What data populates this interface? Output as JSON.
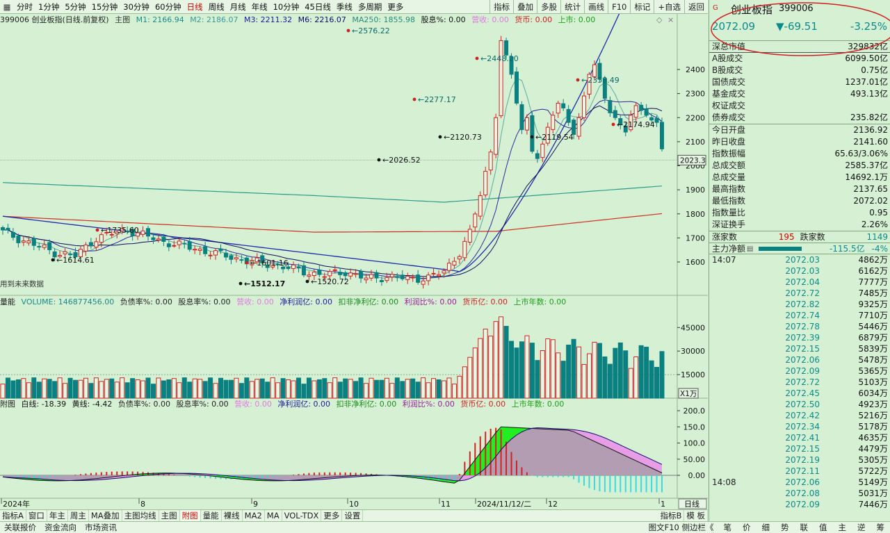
{
  "top_periods": [
    {
      "label": "分时",
      "active": false
    },
    {
      "label": "1分钟",
      "active": false
    },
    {
      "label": "5分钟",
      "active": false
    },
    {
      "label": "15分钟",
      "active": false
    },
    {
      "label": "30分钟",
      "active": false
    },
    {
      "label": "60分钟",
      "active": false
    },
    {
      "label": "日线",
      "active": true
    },
    {
      "label": "周线",
      "active": false
    },
    {
      "label": "月线",
      "active": false
    },
    {
      "label": "年线",
      "active": false
    },
    {
      "label": "10分钟",
      "active": false
    },
    {
      "label": "45日线",
      "active": false
    },
    {
      "label": "季线",
      "active": false
    },
    {
      "label": "多周期",
      "active": false
    },
    {
      "label": "更多",
      "active": false
    }
  ],
  "tool_buttons": [
    "指标",
    "叠加",
    "多股",
    "统计",
    "画线",
    "F10",
    "标记",
    "+自选",
    "返回"
  ],
  "main_info": {
    "title": "399006 创业板指(日线.前复权)",
    "main_label": "主图",
    "m1": "M1: 2166.94",
    "m2": "M2: 2186.07",
    "m3": "M3: 2211.32",
    "m6": "M6: 2216.07",
    "ma250": "MA250: 1855.98",
    "gxl": "股息%: 0.00",
    "yingshou": "营收: 0.00",
    "huobi": "货币: 0.00",
    "shangshi": "上市: 0.00"
  },
  "volume_info": {
    "label": "量能",
    "volume": "VOLUME: 146877456.00",
    "fzl": "负债率%: 0.00",
    "gxl": "股息率%: 0.00",
    "yingshou": "营收: 0.00",
    "jlr": "净利润亿: 0.00",
    "kfjlr": "扣非净利亿: 0.00",
    "lrb": "利润比%: 0.00",
    "hby": "货币亿: 0.00",
    "ssns": "上市年数: 0.00"
  },
  "macd_info": {
    "label": "附图",
    "white": "白线: -18.39",
    "yellow": "黄线: -4.42",
    "fzl": "负债率%: 0.00",
    "gxl": "股息率%: 0.00",
    "yingshou": "营收: 0.00",
    "jlr": "净利润亿: 0.00",
    "kfjlr": "扣非净利亿: 0.00",
    "lrb": "利润比%: 0.00",
    "hby": "货币亿: 0.00",
    "ssns": "上市年数: 0.00"
  },
  "future_data_note": "用到未来数据",
  "price_axis": [
    "2400",
    "2300",
    "2200",
    "2100",
    "2000",
    "1900",
    "1800",
    "1700",
    "1600"
  ],
  "current_price_tag": "2023.3",
  "vol_axis": [
    "45000",
    "30000",
    "15000"
  ],
  "vol_unit": "X1万",
  "macd_axis": [
    "200.0",
    "150.0",
    "100.0",
    "50.00",
    "0.00"
  ],
  "x_labels": [
    {
      "label": "2024年",
      "pos": 0
    },
    {
      "label": "8",
      "pos": 1
    },
    {
      "label": "9",
      "pos": 2
    },
    {
      "label": "10",
      "pos": 3
    },
    {
      "label": "11",
      "pos": 4
    },
    {
      "label": "2024/11/12/二",
      "pos": 5
    },
    {
      "label": "12",
      "pos": 6
    },
    {
      "label": "1",
      "pos": 7
    }
  ],
  "period_tag": "日线",
  "annotations": [
    {
      "label": "2576.22",
      "price": 2576.22
    },
    {
      "label": "2448.20",
      "price": 2448.2
    },
    {
      "label": "2358.49",
      "price": 2358.49
    },
    {
      "label": "2277.17",
      "price": 2277.17
    },
    {
      "label": "2120.73",
      "price": 2120.73
    },
    {
      "label": "2119.54",
      "price": 2119.54
    },
    {
      "label": "2174.94",
      "price": 2174.94
    },
    {
      "label": "2026.52",
      "price": 2026.52
    },
    {
      "label": "1735.60",
      "price": 1735.6
    },
    {
      "label": "1614.61",
      "price": 1614.61
    },
    {
      "label": "1601.16",
      "price": 1601.16
    },
    {
      "label": "1512.17",
      "price": 1512.17
    },
    {
      "label": "1520.72",
      "price": 1520.72
    }
  ],
  "bottom_tabs": [
    {
      "label": "指标A",
      "active": false
    },
    {
      "label": "窗口",
      "active": false
    },
    {
      "label": "年主",
      "active": false
    },
    {
      "label": "周主",
      "active": false
    },
    {
      "label": "MA叠加",
      "active": false
    },
    {
      "label": "主图均线",
      "active": false
    },
    {
      "label": "主图",
      "active": false
    },
    {
      "label": "附图",
      "active": true
    },
    {
      "label": "量能",
      "active": false
    },
    {
      "label": "裸线",
      "active": false
    },
    {
      "label": "MA2",
      "active": false
    },
    {
      "label": "MA",
      "active": false
    },
    {
      "label": "VOL-TDX",
      "active": false
    },
    {
      "label": "更多",
      "active": false
    },
    {
      "label": "设置",
      "active": false
    }
  ],
  "bottom_right_tabs": [
    "指标B",
    "模 板"
  ],
  "status_left": [
    "关联报价",
    "资金流向",
    "市场资讯"
  ],
  "status_right_label": "图文F10 侧边栏《",
  "status_right": [
    "笔",
    "价",
    "细",
    "势",
    "联",
    "值",
    "主",
    "逆",
    "筹"
  ],
  "quote": {
    "name": "创业板指",
    "code": "399006",
    "price": "2072.09",
    "change": "▼-69.51",
    "pct": "-3.25%",
    "accent": "#0a8a8a",
    "circle_color": "#d02020"
  },
  "stats_top": [
    {
      "label": "深总市值",
      "value": "329832亿"
    },
    {
      "label": "A股成交",
      "value": "6099.50亿"
    },
    {
      "label": "B股成交",
      "value": "0.75亿"
    },
    {
      "label": "国债成交",
      "value": "1237.01亿"
    },
    {
      "label": "基金成交",
      "value": "493.13亿"
    },
    {
      "label": "权证成交",
      "value": ""
    },
    {
      "label": "债券成交",
      "value": "235.82亿"
    }
  ],
  "stats_bottom": [
    {
      "label": "今日开盘",
      "value": "2136.92",
      "color": "grn"
    },
    {
      "label": "昨日收盘",
      "value": "2141.60",
      "color": ""
    },
    {
      "label": "指数振幅",
      "value": "65.63/3.06%",
      "color": ""
    },
    {
      "label": "总成交额",
      "value": "2585.37亿",
      "color": ""
    },
    {
      "label": "总成交量",
      "value": "14692.1万",
      "color": ""
    },
    {
      "label": "最高指数",
      "value": "2137.65",
      "color": "grn"
    },
    {
      "label": "最低指数",
      "value": "2072.02",
      "color": "grn"
    },
    {
      "label": "指数量比",
      "value": "0.95",
      "color": "red"
    },
    {
      "label": "深证换手",
      "value": "2.26%",
      "color": ""
    }
  ],
  "breadth": {
    "up_label": "涨家数",
    "up_value": "195",
    "down_label": "跌家数",
    "down_value": "1149"
  },
  "net_flow": {
    "label": "主力净额",
    "value": "-115.5亿",
    "pct": "-4%"
  },
  "trades": [
    {
      "time": "14:07",
      "price": "2072.03",
      "qty": "4862万"
    },
    {
      "time": "",
      "price": "2072.03",
      "qty": "6162万"
    },
    {
      "time": "",
      "price": "2072.04",
      "qty": "7777万"
    },
    {
      "time": "",
      "price": "2072.72",
      "qty": "7485万"
    },
    {
      "time": "",
      "price": "2072.82",
      "qty": "9325万"
    },
    {
      "time": "",
      "price": "2072.74",
      "qty": "7710万"
    },
    {
      "time": "",
      "price": "2072.78",
      "qty": "5446万"
    },
    {
      "time": "",
      "price": "2072.39",
      "qty": "6879万"
    },
    {
      "time": "",
      "price": "2072.15",
      "qty": "5839万"
    },
    {
      "time": "",
      "price": "2072.06",
      "qty": "5478万"
    },
    {
      "time": "",
      "price": "2072.09",
      "qty": "5365万"
    },
    {
      "time": "",
      "price": "2072.72",
      "qty": "5103万"
    },
    {
      "time": "",
      "price": "2072.45",
      "qty": "6034万"
    },
    {
      "time": "",
      "price": "2072.50",
      "qty": "4923万"
    },
    {
      "time": "",
      "price": "2072.42",
      "qty": "5216万"
    },
    {
      "time": "",
      "price": "2072.34",
      "qty": "5178万"
    },
    {
      "time": "",
      "price": "2072.41",
      "qty": "4635万"
    },
    {
      "time": "",
      "price": "2072.15",
      "qty": "4479万"
    },
    {
      "time": "",
      "price": "2072.19",
      "qty": "5305万"
    },
    {
      "time": "",
      "price": "2072.11",
      "qty": "5722万"
    },
    {
      "time": "14:08",
      "price": "2072.06",
      "qty": "5149万"
    },
    {
      "time": "",
      "price": "2072.08",
      "qty": "5031万"
    },
    {
      "time": "",
      "price": "2072.09",
      "qty": "7446万"
    }
  ],
  "colors": {
    "up": "#d42020",
    "down": "#0a8080",
    "bg": "#d6f0d4"
  }
}
